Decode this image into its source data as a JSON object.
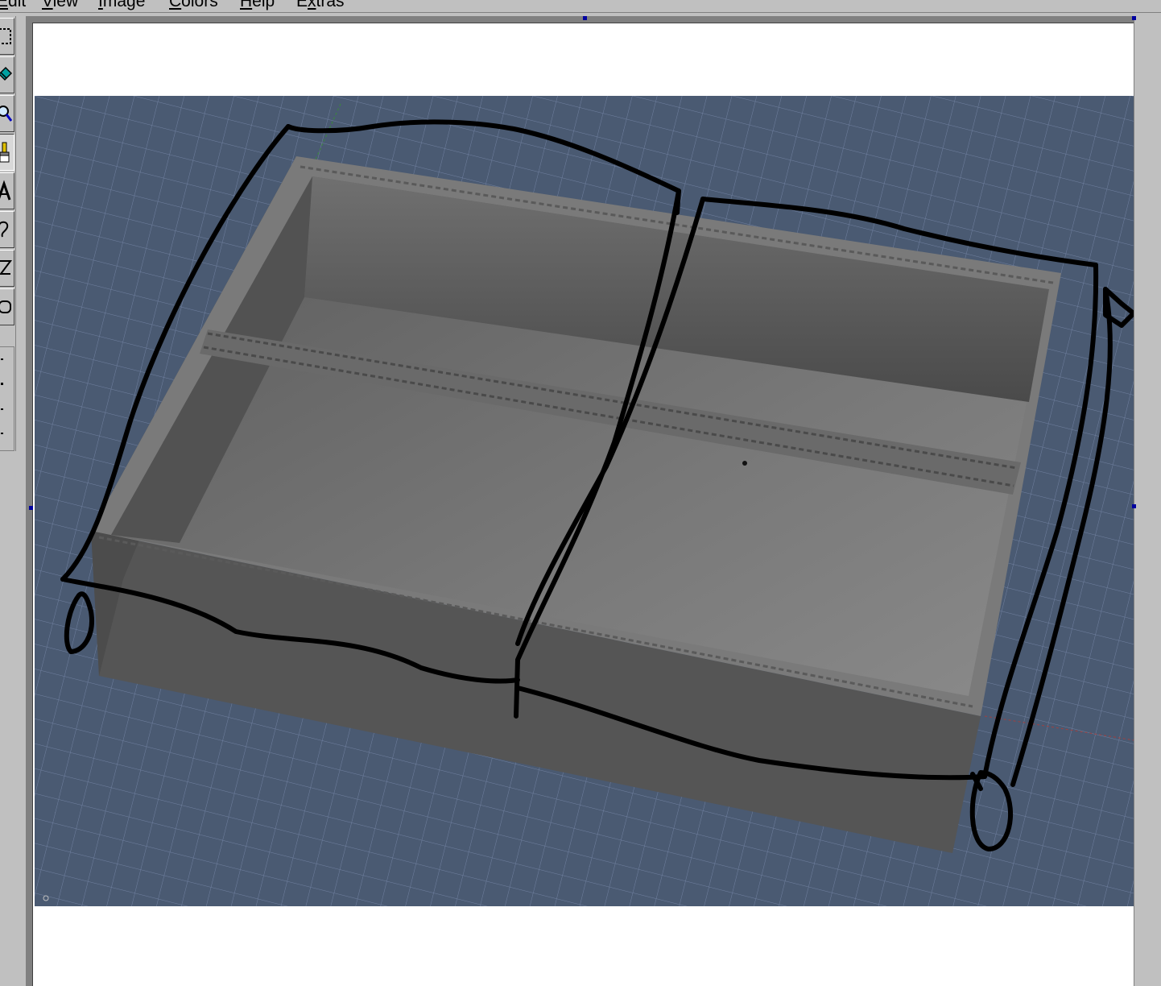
{
  "menu": {
    "items": [
      {
        "id": "edit",
        "mnemonic": "E",
        "rest": "dit"
      },
      {
        "id": "view",
        "mnemonic": "V",
        "rest": "iew"
      },
      {
        "id": "image",
        "mnemonic": "I",
        "rest": "mage"
      },
      {
        "id": "colors",
        "mnemonic": "C",
        "rest": "olors"
      },
      {
        "id": "help",
        "mnemonic": "H",
        "rest": "elp"
      },
      {
        "id": "extras",
        "mnemonic": "x",
        "prefix": "E",
        "rest": "tras"
      }
    ]
  },
  "toolbox": {
    "tools": [
      {
        "id": "select",
        "icon": "rect-select-icon"
      },
      {
        "id": "fill",
        "icon": "paint-bucket-icon"
      },
      {
        "id": "magnifier",
        "icon": "magnifier-icon"
      },
      {
        "id": "brush",
        "icon": "brush-icon",
        "active": true
      },
      {
        "id": "text",
        "icon": "text-icon"
      },
      {
        "id": "curve",
        "icon": "curve-icon"
      },
      {
        "id": "polygon",
        "icon": "polygon-icon"
      },
      {
        "id": "rounded-rect",
        "icon": "rounded-rect-icon"
      }
    ]
  },
  "canvas": {
    "background": "#ffffff",
    "scene_background": "#4a5a72",
    "grid_color": "#7080a0",
    "box_color": "#6a6a6a",
    "ink_color": "#000000"
  }
}
